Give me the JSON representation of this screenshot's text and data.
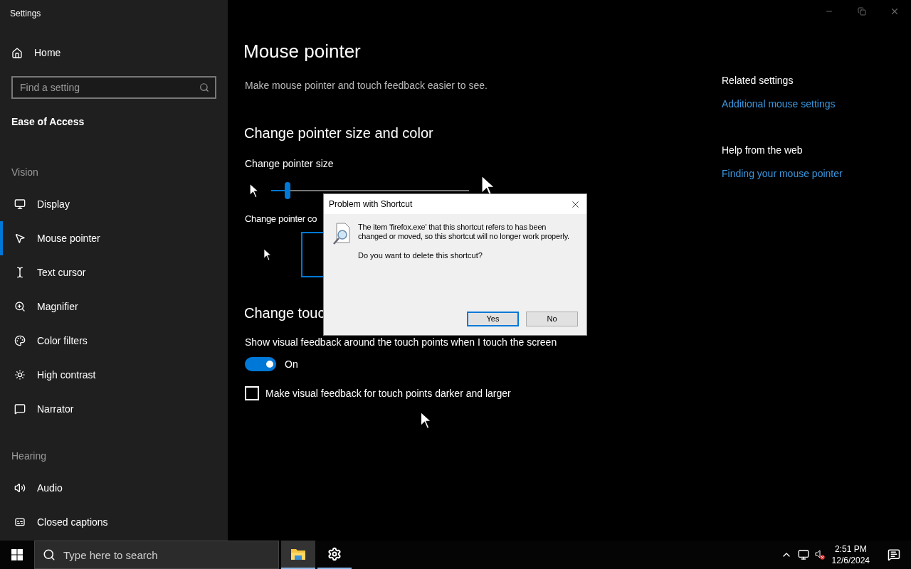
{
  "window": {
    "title": "Settings"
  },
  "sidebar": {
    "home": "Home",
    "search": {
      "placeholder": "Find a setting"
    },
    "category": "Ease of Access",
    "groups": [
      {
        "heading": "Vision",
        "items": [
          {
            "label": "Display",
            "selected": false
          },
          {
            "label": "Mouse pointer",
            "selected": true
          },
          {
            "label": "Text cursor",
            "selected": false
          },
          {
            "label": "Magnifier",
            "selected": false
          },
          {
            "label": "Color filters",
            "selected": false
          },
          {
            "label": "High contrast",
            "selected": false
          },
          {
            "label": "Narrator",
            "selected": false
          }
        ]
      },
      {
        "heading": "Hearing",
        "items": [
          {
            "label": "Audio",
            "selected": false
          },
          {
            "label": "Closed captions",
            "selected": false
          }
        ]
      }
    ]
  },
  "main": {
    "title": "Mouse pointer",
    "description": "Make mouse pointer and touch feedback easier to see.",
    "pointer_section": {
      "heading": "Change pointer size and color",
      "size_label": "Change pointer size",
      "size_slider": {
        "level": 0.08
      },
      "color_label": "Change pointer co"
    },
    "touch_section": {
      "heading": "Change touc",
      "feedback_label": "Show visual feedback around the touch points when I touch the screen",
      "toggle": {
        "on": true,
        "label": "On"
      },
      "checkbox": {
        "label": "Make visual feedback for touch points darker and larger",
        "checked": false
      }
    }
  },
  "related": [
    {
      "heading": "Related settings",
      "link": "Additional mouse settings"
    },
    {
      "heading": "Help from the web",
      "link": "Finding your mouse pointer"
    }
  ],
  "dialog": {
    "title": "Problem with Shortcut",
    "message": "The item 'firefox.exe' that this shortcut refers to has been changed or moved, so this shortcut will no longer work properly.",
    "question": "Do you want to delete this shortcut?",
    "buttons": [
      {
        "label": "Yes",
        "focused": true
      },
      {
        "label": "No",
        "focused": false
      }
    ]
  },
  "taskbar": {
    "search": {
      "placeholder": "Type here to search"
    },
    "apps": [
      {
        "kind": "explorer",
        "selected": true
      },
      {
        "kind": "settings",
        "selected": false
      }
    ],
    "time": "2:51 PM",
    "date": "12/6/2024"
  }
}
